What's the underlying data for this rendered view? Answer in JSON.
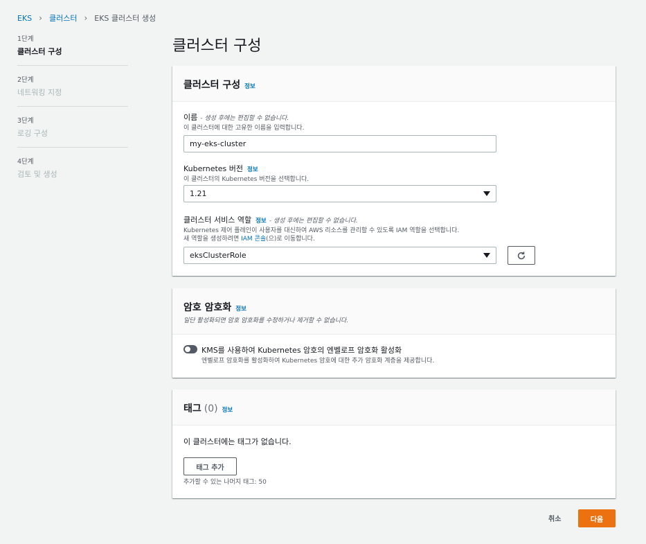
{
  "breadcrumb": {
    "items": [
      "EKS",
      "클러스터",
      "EKS 클러스터 생성"
    ]
  },
  "steps": [
    {
      "num": "1단계",
      "name": "클러스터 구성"
    },
    {
      "num": "2단계",
      "name": "네트워킹 지정"
    },
    {
      "num": "3단계",
      "name": "로깅 구성"
    },
    {
      "num": "4단계",
      "name": "검토 및 생성"
    }
  ],
  "page_title": "클러스터 구성",
  "cluster_config": {
    "title": "클러스터 구성",
    "info": "정보",
    "name_label": "이름",
    "name_note": "- 생성 후에는 편집할 수 없습니다.",
    "name_desc": "이 클러스터에 대한 고유한 이름을 입력합니다.",
    "name_value": "my-eks-cluster",
    "k8s_label": "Kubernetes 버전",
    "k8s_info": "정보",
    "k8s_desc": "이 클러스터의 Kubernetes 버전을 선택합니다.",
    "k8s_value": "1.21",
    "role_label": "클러스터 서비스 역할",
    "role_info": "정보",
    "role_note": "- 생성 후에는 편집할 수 없습니다.",
    "role_desc1": "Kubernetes 제어 플레인이 사용자를 대신하여 AWS 리소스를 관리할 수 있도록 IAM 역할을 선택합니다.",
    "role_desc2_pre": "새 역할을 생성하려면 ",
    "role_desc2_link": "IAM 콘솔",
    "role_desc2_post": "(으)로 이동합니다.",
    "role_value": "eksClusterRole"
  },
  "encryption": {
    "title": "암호 암호화",
    "info": "정보",
    "subtitle": "일단 활성화되면 암호 암호화를 수정하거나 제거할 수 없습니다.",
    "toggle_label": "KMS를 사용하여 Kubernetes 암호의 엔벨로프 암호화 활성화",
    "toggle_desc": "엔벨로프 암호화를 활성화하여 Kubernetes 암호에 대한 추가 암호화 계층을 제공합니다."
  },
  "tags": {
    "title": "태그",
    "count": "(0)",
    "info": "정보",
    "empty_text": "이 클러스터에는 태그가 없습니다.",
    "add_button": "태그 추가",
    "remaining": "추가할 수 있는 나머지 태그: 50"
  },
  "footer": {
    "cancel": "취소",
    "next": "다음"
  },
  "colors": {
    "link": "#0073bb",
    "primary": "#ec7211",
    "background": "#f2f3f3"
  }
}
